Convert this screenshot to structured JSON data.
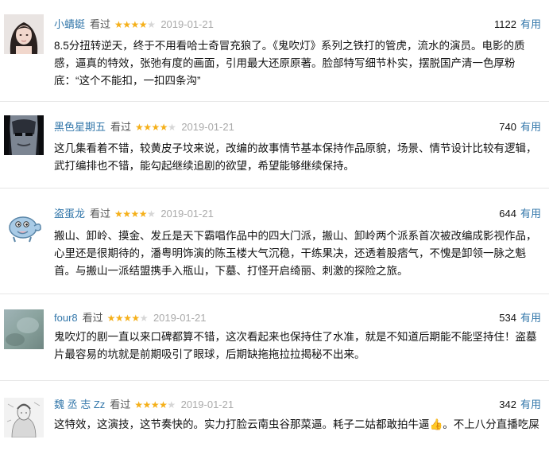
{
  "comments": [
    {
      "user": "小蜻蜓",
      "status": "看过",
      "rating": 4,
      "date": "2019-01-21",
      "votes": "1122",
      "useful_label": "有用",
      "avatar_icon": "woman-portrait",
      "text": "8.5分扭转逆天，终于不用看哈士奇冒充狼了。《鬼吹灯》系列之铁打的管虎，流水的演员。电影的质感，逼真的特效，张弛有度的画面，引用最大还原原著。脸部特写细节朴实，摆脱国产清一色厚粉底：“这个不能扣，一扣四条沟”"
    },
    {
      "user": "黑色星期五",
      "status": "看过",
      "rating": 4,
      "date": "2019-01-21",
      "votes": "740",
      "useful_label": "有用",
      "avatar_icon": "masked-face",
      "text": "这几集看着不错，较黄皮子坟来说，改编的故事情节基本保持作品原貌，场景、情节设计比较有逻辑，武打编排也不错，能勾起继续追剧的欲望，希望能够继续保持。"
    },
    {
      "user": "盗蛋龙",
      "status": "看过",
      "rating": 4,
      "date": "2019-01-21",
      "votes": "644",
      "useful_label": "有用",
      "avatar_icon": "cartoon-dinosaur",
      "text": "搬山、卸岭、摸金、发丘是天下霸唱作品中的四大门派，搬山、卸岭两个派系首次被改编成影视作品，心里还是很期待的，潘粤明饰演的陈玉楼大气沉稳，干练果决，还透着股痞气，不愧是卸领一脉之魁首。与搬山一派结盟携手入瓶山，下墓、打怪开启绮丽、刺激的探险之旅。"
    },
    {
      "user": "four8",
      "status": "看过",
      "rating": 4,
      "date": "2019-01-21",
      "votes": "534",
      "useful_label": "有用",
      "avatar_icon": "blurred-photo",
      "text": "鬼吹灯的剧一直以来口碑都算不错，这次看起来也保持住了水准，就是不知道后期能不能坚持住！盗墓片最容易的坑就是前期吸引了眼球，后期缺拖拖拉拉揭秘不出来。"
    },
    {
      "user": "魏 丞 志 Zz",
      "status": "看过",
      "rating": 4,
      "date": "2019-01-21",
      "votes": "342",
      "useful_label": "有用",
      "avatar_icon": "sketch-portrait",
      "text": "这特效，这演技，这节奏快的。实力打脸云南虫谷那菜逼。耗子二姑都敢拍牛逼👍。不上八分直播吃屎"
    }
  ]
}
